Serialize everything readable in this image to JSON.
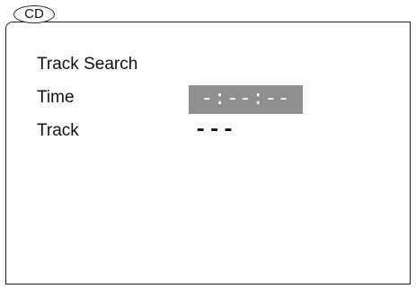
{
  "tab": {
    "label": "CD"
  },
  "panel": {
    "title": "Track Search",
    "time_label": "Time",
    "time_value": "-:--:--",
    "track_label": "Track",
    "track_value": "---"
  }
}
